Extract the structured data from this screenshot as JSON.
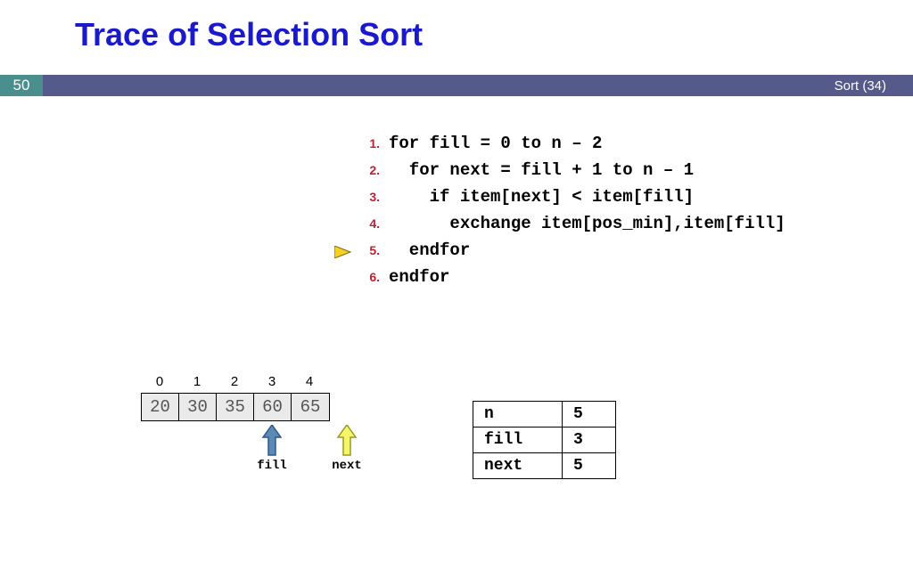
{
  "title": "Trace of Selection Sort",
  "page_number": "50",
  "header_right": "Sort (34)",
  "code": {
    "current_line_index": 4,
    "lines": [
      {
        "num": "1.",
        "text": "for fill = 0 to n – 2"
      },
      {
        "num": "2.",
        "text": "  for next = fill + 1 to n – 1"
      },
      {
        "num": "3.",
        "text": "    if item[next] < item[fill]"
      },
      {
        "num": "4.",
        "text": "      exchange item[pos_min],item[fill]"
      },
      {
        "num": "5.",
        "text": "  endfor"
      },
      {
        "num": "6.",
        "text": "endfor"
      }
    ]
  },
  "array": {
    "indices": [
      "0",
      "1",
      "2",
      "3",
      "4"
    ],
    "values": [
      "20",
      "30",
      "35",
      "60",
      "65"
    ],
    "pointers": [
      {
        "label": "fill",
        "index": 3,
        "fill_color": "#5a8ab5",
        "stroke": "#2a5a85"
      },
      {
        "label": "next",
        "index": 5,
        "fill_color": "#f5f56a",
        "stroke": "#9a9a20"
      }
    ]
  },
  "vars": [
    {
      "k": "n",
      "v": "5"
    },
    {
      "k": "fill",
      "v": "3"
    },
    {
      "k": "next",
      "v": "5"
    }
  ]
}
